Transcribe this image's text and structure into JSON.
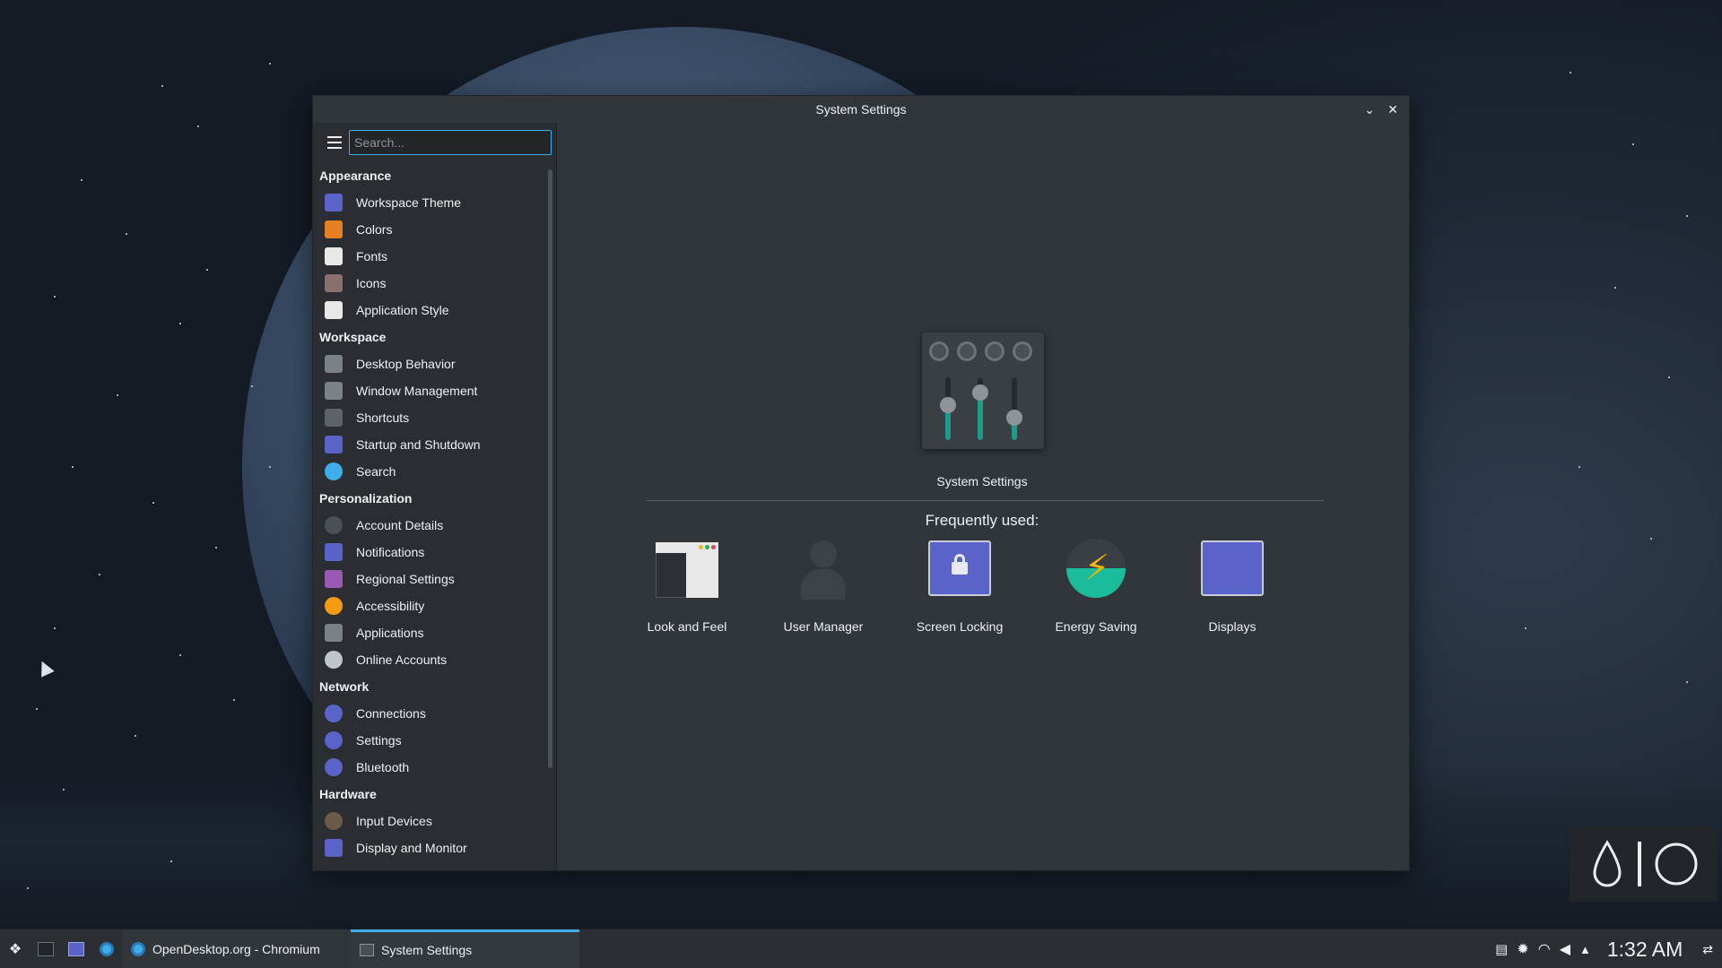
{
  "window": {
    "title": "System Settings",
    "minimize_glyph": "⌄",
    "close_glyph": "✕"
  },
  "search": {
    "placeholder": "Search..."
  },
  "sidebar": {
    "categories": [
      {
        "header": "Appearance",
        "items": [
          {
            "label": "Workspace Theme",
            "icon": "workspace-theme-icon"
          },
          {
            "label": "Colors",
            "icon": "colors-icon"
          },
          {
            "label": "Fonts",
            "icon": "fonts-icon"
          },
          {
            "label": "Icons",
            "icon": "icons-icon"
          },
          {
            "label": "Application Style",
            "icon": "application-style-icon"
          }
        ]
      },
      {
        "header": "Workspace",
        "items": [
          {
            "label": "Desktop Behavior",
            "icon": "desktop-behavior-icon"
          },
          {
            "label": "Window Management",
            "icon": "window-management-icon"
          },
          {
            "label": "Shortcuts",
            "icon": "shortcuts-icon"
          },
          {
            "label": "Startup and Shutdown",
            "icon": "startup-shutdown-icon"
          },
          {
            "label": "Search",
            "icon": "search-icon"
          }
        ]
      },
      {
        "header": "Personalization",
        "items": [
          {
            "label": "Account Details",
            "icon": "account-icon"
          },
          {
            "label": "Notifications",
            "icon": "notifications-icon"
          },
          {
            "label": "Regional Settings",
            "icon": "regional-icon"
          },
          {
            "label": "Accessibility",
            "icon": "accessibility-icon"
          },
          {
            "label": "Applications",
            "icon": "applications-icon"
          },
          {
            "label": "Online Accounts",
            "icon": "online-accounts-icon"
          }
        ]
      },
      {
        "header": "Network",
        "items": [
          {
            "label": "Connections",
            "icon": "connections-icon"
          },
          {
            "label": "Settings",
            "icon": "network-settings-icon"
          },
          {
            "label": "Bluetooth",
            "icon": "bluetooth-icon"
          }
        ]
      },
      {
        "header": "Hardware",
        "items": [
          {
            "label": "Input Devices",
            "icon": "input-devices-icon"
          },
          {
            "label": "Display and Monitor",
            "icon": "display-monitor-icon"
          }
        ]
      }
    ]
  },
  "main": {
    "hero_label": "System Settings",
    "frequently_used_title": "Frequently used:",
    "frequently_used": [
      {
        "label": "Look and Feel",
        "icon": "look-and-feel-icon"
      },
      {
        "label": "User Manager",
        "icon": "user-manager-icon"
      },
      {
        "label": "Screen Locking",
        "icon": "screen-locking-icon"
      },
      {
        "label": "Energy Saving",
        "icon": "energy-saving-icon"
      },
      {
        "label": "Displays",
        "icon": "displays-icon"
      }
    ]
  },
  "taskbar": {
    "tasks": [
      {
        "label": "OpenDesktop.org - Chromium",
        "icon": "chromium-icon"
      },
      {
        "label": "System Settings",
        "icon": "system-settings-icon"
      }
    ],
    "clock": "1:32 AM"
  },
  "colors": {
    "accent": "#3daee9",
    "window_bg": "#31363b",
    "sidebar_bg": "#2a2e32",
    "teal": "#1d9b8c"
  }
}
